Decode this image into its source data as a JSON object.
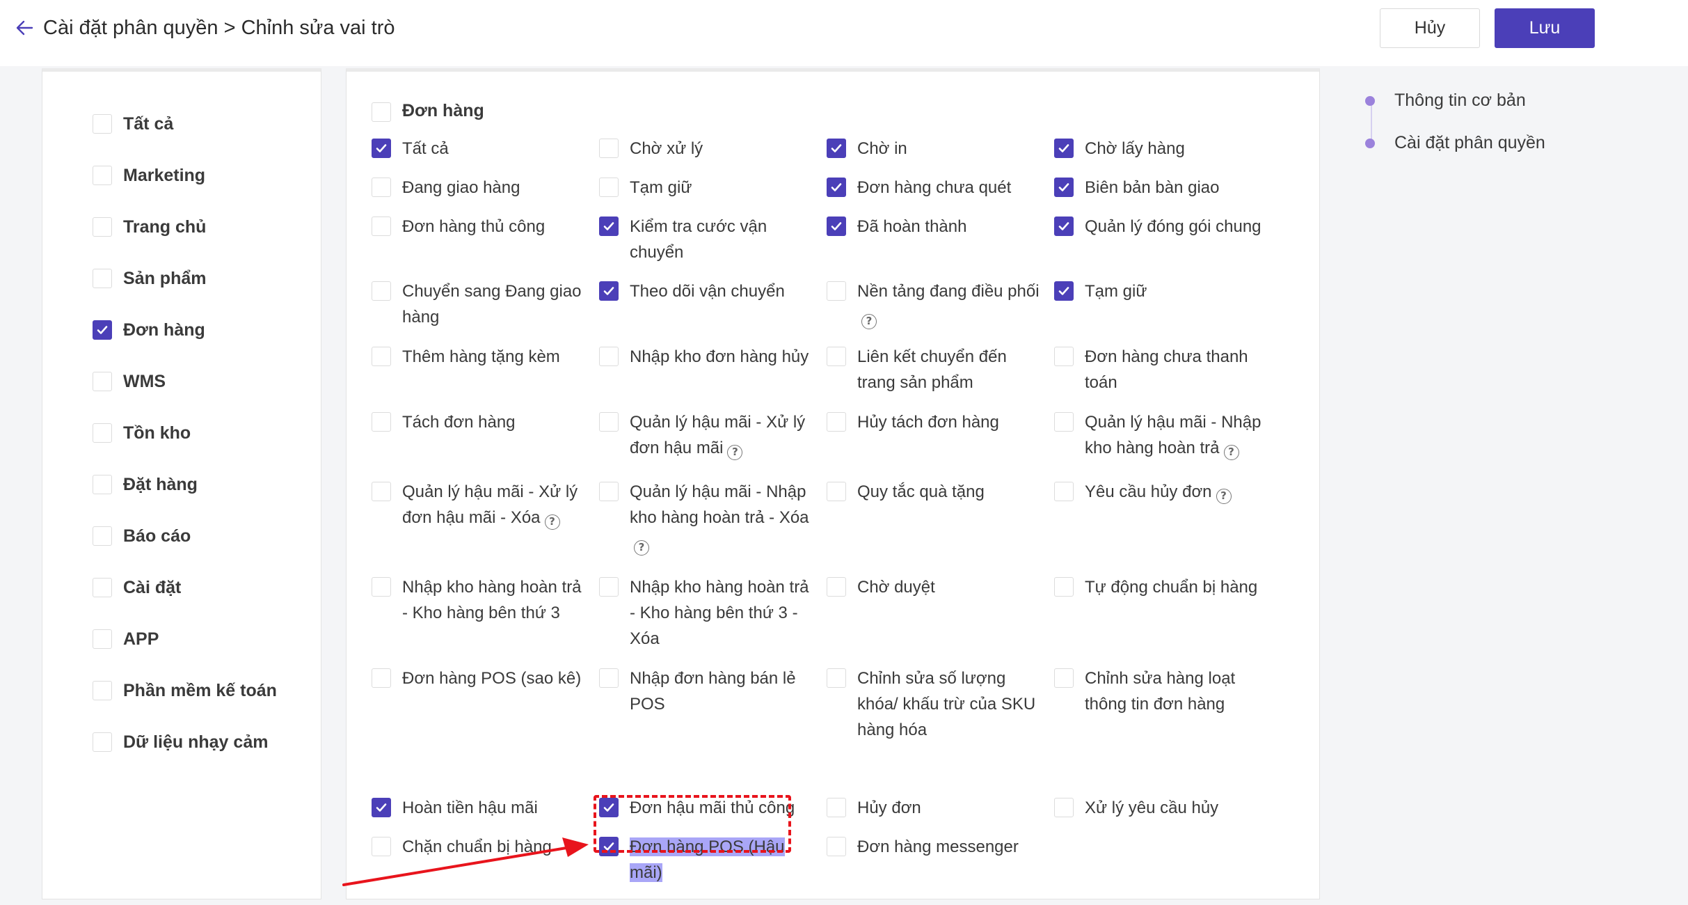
{
  "header": {
    "title": "Cài đặt phân quyền > Chỉnh sửa vai trò",
    "cancel_label": "Hủy",
    "save_label": "Lưu"
  },
  "colors": {
    "accent": "#4b3fb8",
    "highlight": "#a9a6f7",
    "annotation": "#e8141c"
  },
  "icons": {
    "back": "arrow-left-icon",
    "check": "check-icon",
    "help": "question-circle-icon"
  },
  "modules": [
    {
      "label": "Tất cả",
      "checked": false
    },
    {
      "label": "Marketing",
      "checked": false
    },
    {
      "label": "Trang chủ",
      "checked": false
    },
    {
      "label": "Sản phẩm",
      "checked": false
    },
    {
      "label": "Đơn hàng",
      "checked": true
    },
    {
      "label": "WMS",
      "checked": false
    },
    {
      "label": "Tồn kho",
      "checked": false
    },
    {
      "label": "Đặt hàng",
      "checked": false
    },
    {
      "label": "Báo cáo",
      "checked": false
    },
    {
      "label": "Cài đặt",
      "checked": false
    },
    {
      "label": "APP",
      "checked": false
    },
    {
      "label": "Phần mềm kế toán",
      "checked": false
    },
    {
      "label": "Dữ liệu nhạy cảm",
      "checked": false
    }
  ],
  "section": {
    "title": "Đơn hàng",
    "checked": false,
    "permissions": [
      {
        "label": "Tất cả",
        "checked": true
      },
      {
        "label": "Chờ xử lý",
        "checked": false
      },
      {
        "label": "Chờ in",
        "checked": true
      },
      {
        "label": "Chờ lấy hàng",
        "checked": true
      },
      {
        "label": "Đang giao hàng",
        "checked": false
      },
      {
        "label": "Tạm giữ",
        "checked": false
      },
      {
        "label": "Đơn hàng chưa quét",
        "checked": true
      },
      {
        "label": "Biên bản bàn giao",
        "checked": true
      },
      {
        "label": "Đơn hàng thủ công",
        "checked": false
      },
      {
        "label": "Kiểm tra cước vận chuyển",
        "checked": true
      },
      {
        "label": "Đã hoàn thành",
        "checked": true
      },
      {
        "label": "Quản lý đóng gói chung",
        "checked": true
      },
      {
        "label": "Chuyển sang Đang giao hàng",
        "checked": false
      },
      {
        "label": "Theo dõi vận chuyển",
        "checked": true
      },
      {
        "label": "Nền tảng đang điều phối",
        "checked": false,
        "help": true
      },
      {
        "label": "Tạm giữ",
        "checked": true
      },
      {
        "label": "Thêm hàng tặng kèm",
        "checked": false
      },
      {
        "label": "Nhập kho đơn hàng hủy",
        "checked": false
      },
      {
        "label": "Liên kết chuyển đến trang sản phẩm",
        "checked": false
      },
      {
        "label": "Đơn hàng chưa thanh toán",
        "checked": false
      },
      {
        "label": "Tách đơn hàng",
        "checked": false
      },
      {
        "label": "Quản lý hậu mãi - Xử lý đơn hậu mãi",
        "checked": false,
        "help": true
      },
      {
        "label": "Hủy tách đơn hàng",
        "checked": false
      },
      {
        "label": "Quản lý hậu mãi - Nhập kho hàng hoàn trả",
        "checked": false,
        "help": true
      },
      {
        "label": "Quản lý hậu mãi - Xử lý đơn hậu mãi - Xóa",
        "checked": false,
        "help": true
      },
      {
        "label": "Quản lý hậu mãi - Nhập kho hàng hoàn trả - Xóa",
        "checked": false,
        "help": true
      },
      {
        "label": "Quy tắc quà tặng",
        "checked": false
      },
      {
        "label": "Yêu cầu hủy đơn",
        "checked": false,
        "help": true
      },
      {
        "label": "Nhập kho hàng hoàn trả - Kho hàng bên thứ 3",
        "checked": false
      },
      {
        "label": "Nhập kho hàng hoàn trả - Kho hàng bên thứ 3 - Xóa",
        "checked": false
      },
      {
        "label": "Chờ duyệt",
        "checked": false
      },
      {
        "label": "Tự động chuẩn bị hàng",
        "checked": false
      },
      {
        "label": "Đơn hàng POS (sao kê)",
        "checked": false
      },
      {
        "label": "Nhập đơn hàng bán lẻ POS",
        "checked": false
      },
      {
        "label": "Chỉnh sửa số lượng khóa/ khấu trừ của SKU hàng hóa",
        "checked": false
      },
      {
        "label": "Chỉnh sửa hàng loạt thông tin đơn hàng",
        "checked": false
      },
      {
        "label": "Hoàn tiền hậu mãi",
        "checked": true
      },
      {
        "label": "Đơn hậu mãi thủ công",
        "checked": true
      },
      {
        "label": "Hủy đơn",
        "checked": false
      },
      {
        "label": "Xử lý yêu cầu hủy",
        "checked": false
      },
      {
        "label": "Chặn chuẩn bị hàng",
        "checked": false
      },
      {
        "label": "Đơn hàng POS (Hậu mãi)",
        "checked": true,
        "highlighted": true
      },
      {
        "label": "Đơn hàng messenger",
        "checked": false
      }
    ]
  },
  "anchor_nav": [
    {
      "label": "Thông tin cơ bản"
    },
    {
      "label": "Cài đặt phân quyền"
    }
  ]
}
